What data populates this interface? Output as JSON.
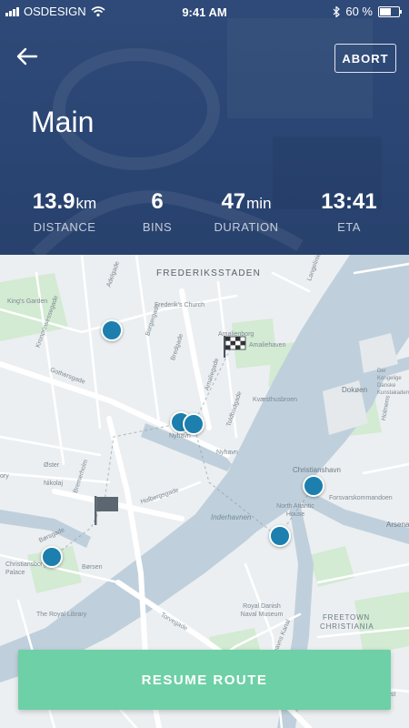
{
  "status_bar": {
    "carrier": "OSDESIGN",
    "time": "9:41 AM",
    "battery_label": "60 %",
    "battery_level": 0.6
  },
  "header": {
    "back_icon": "arrow-left-icon",
    "abort_label": "ABORT",
    "title": "Main"
  },
  "stats": [
    {
      "value": "13.9",
      "unit": "km",
      "label": "DISTANCE"
    },
    {
      "value": "6",
      "unit": "",
      "label": "BINS"
    },
    {
      "value": "47",
      "unit": "min",
      "label": "DURATION"
    },
    {
      "value": "13:41",
      "unit": "",
      "label": "ETA"
    }
  ],
  "map": {
    "labels": {
      "frederiksstaden": "FREDERIKSSTADEN",
      "kings_garden": "King's Garden",
      "frederiks_church": "Frederik's Church",
      "amalienborg": "Amalienborg",
      "amaliehaven": "Amaliehaven",
      "kvaesthusbroen": "Kvæsthusbroen",
      "nyhavn1": "Nyhavn",
      "nyhavn2": "Nyhavn",
      "christianshavn": "Christianshavn",
      "forsvarskommandoen": "Forsvarskommandoen",
      "north_atlantic": "North Atlantic House",
      "inderhavnen": "Inderhavnen",
      "christiansborg": "Christiansborg Palace",
      "borsen": "Børsen",
      "royal_library": "The Royal Library",
      "royal_danish_naval": "Royal Danish Naval Museum",
      "freetown": "FREETOWN CHRISTIANIA",
      "dokoen": "Dokøen",
      "holmens": "Holmens",
      "arsenal": "Arsena",
      "der_kongelige": "Der Kongelige Danske Kunstakademi",
      "gothersgade": "Gothersgade",
      "kronprinsessegade": "Kronprinsessegade",
      "adelgade": "Adelgade",
      "bredgade": "Bredgade",
      "amaliegade": "Amaliegade",
      "toldbodgade": "Toldbodgade",
      "borgergade": "Borgergade",
      "oster": "Øster",
      "holbergsgade": "Holbergsgade",
      "nikolaj": "Nikolaj",
      "bremerholm": "Bremerholm",
      "borsgade": "Børsgade",
      "torvegade": "Torvegade",
      "langelinie": "Langelinie",
      "christianshavns_kanal": "Christianshavns Kanal",
      "vennelyst": "Vennelyst",
      "ory": "ory"
    },
    "pins": [
      "bin-1",
      "bin-2",
      "bin-3",
      "bin-4",
      "bin-5",
      "bin-6"
    ]
  },
  "resume_label": "RESUME ROUTE",
  "colors": {
    "header_bg": "#2a4573",
    "pin": "#1c7fae",
    "resume_bg": "#6ed0a6",
    "water": "#bfd0dc",
    "park": "#cfe8d0"
  }
}
